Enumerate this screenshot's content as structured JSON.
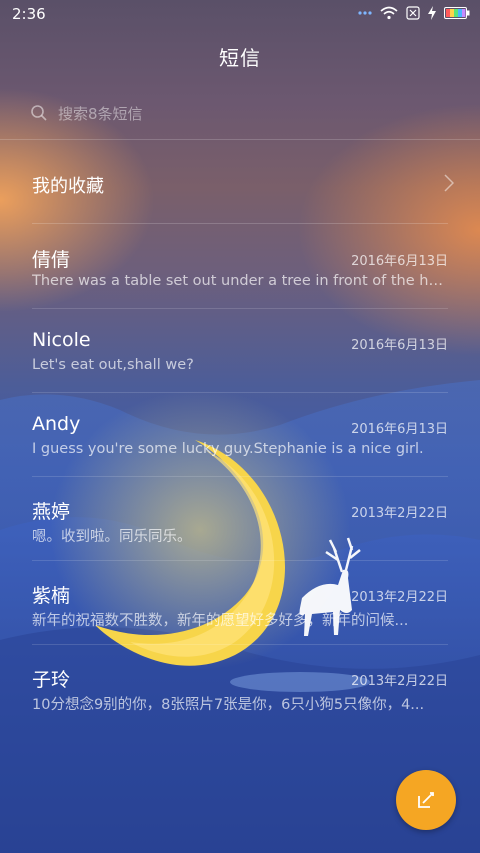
{
  "status_bar": {
    "time": "2:36",
    "icons": [
      "dots-icon",
      "wifi-icon",
      "sim-blocked-icon",
      "charging-icon",
      "battery-icon"
    ]
  },
  "header": {
    "title": "短信"
  },
  "search": {
    "placeholder": "搜索8条短信"
  },
  "favorites": {
    "label": "我的收藏"
  },
  "conversations": [
    {
      "name": "倩倩",
      "date": "2016年6月13日",
      "preview": "There was a table set out under a tree in front of the ho..."
    },
    {
      "name": "Nicole",
      "date": "2016年6月13日",
      "preview": "Let's eat out,shall we?"
    },
    {
      "name": "Andy",
      "date": "2016年6月13日",
      "preview": "I guess you're some lucky guy.Stephanie is a nice girl."
    },
    {
      "name": "燕婷",
      "date": "2013年2月22日",
      "preview": "嗯。收到啦。同乐同乐。"
    },
    {
      "name": "紫楠",
      "date": "2013年2月22日",
      "preview": "新年的祝福数不胜数，新年的愿望好多好多，新年的问候..."
    },
    {
      "name": "子玲",
      "date": "2013年2月22日",
      "preview": "10分想念9别的你，8张照片7张是你，6只小狗5只像你，4..."
    }
  ],
  "fab": {
    "icon": "compose-icon"
  },
  "colors": {
    "accent": "#f5a623",
    "moon": "#f7d54a"
  }
}
